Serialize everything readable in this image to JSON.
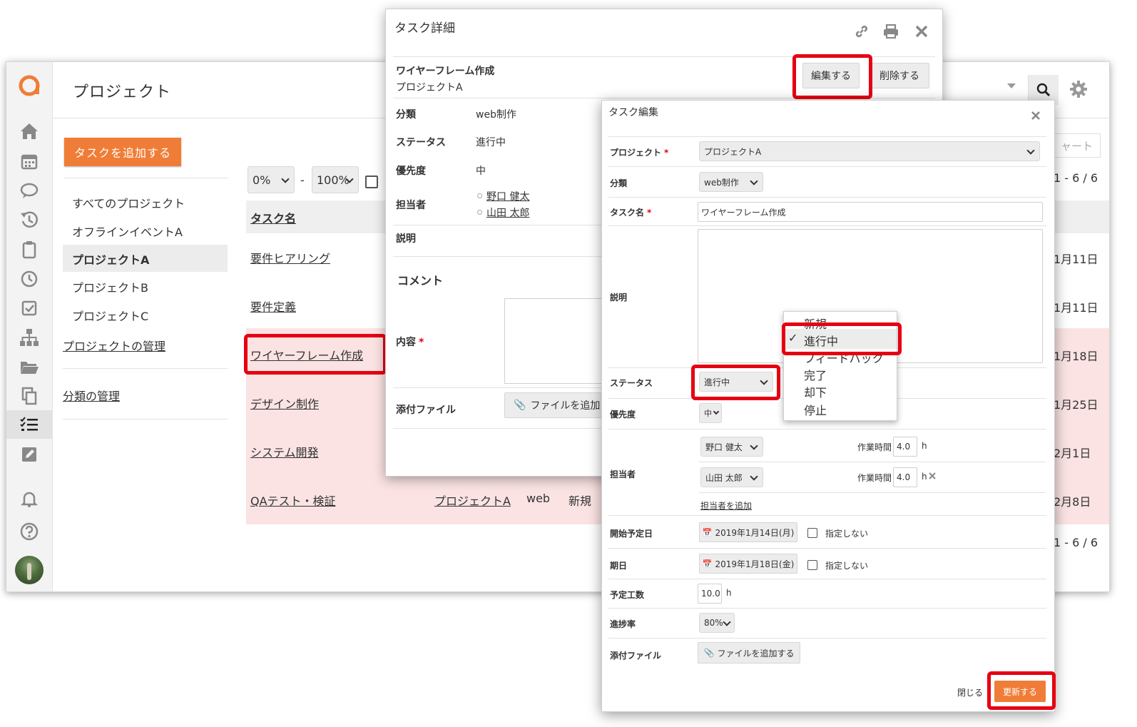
{
  "app": {
    "page_title": "プロジェクト",
    "add_task_button": "タスクを追加する",
    "sidebar": {
      "items": [
        {
          "label": "すべてのプロジェクト"
        },
        {
          "label": "オフラインイベントA"
        },
        {
          "label": "プロジェクトA"
        },
        {
          "label": "プロジェクトB"
        },
        {
          "label": "プロジェクトC"
        }
      ],
      "manage_projects": "プロジェクトの管理",
      "manage_categories": "分類の管理"
    },
    "filter": {
      "from": "0%",
      "dash": "-",
      "to": "100%"
    },
    "table": {
      "header_task": "タスク名",
      "rows": [
        {
          "name": "要件ヒアリング",
          "date": "1月11日"
        },
        {
          "name": "要件定義",
          "date": "1月11日"
        },
        {
          "name": "ワイヤーフレーム作成",
          "date": "1月18日"
        },
        {
          "name": "デザイン制作",
          "date": "1月25日"
        },
        {
          "name": "システム開発",
          "date": "2月1日"
        },
        {
          "name": "QAテスト・検証",
          "date": "2月8日",
          "project": "プロジェクトA",
          "category": "web",
          "status": "新規"
        }
      ],
      "pager_top": "1 - 6 / 6",
      "pager_bottom": "1 - 6 / 6",
      "chart_button": "ャート"
    },
    "accent_color": "#f07d37",
    "highlight_color": "#e60012"
  },
  "detail": {
    "title": "タスク詳細",
    "task_name": "ワイヤーフレーム作成",
    "project": "プロジェクトA",
    "edit_button": "編集する",
    "delete_button": "削除する",
    "fields": {
      "category_label": "分類",
      "category": "web制作",
      "status_label": "ステータス",
      "status": "進行中",
      "priority_label": "優先度",
      "priority": "中",
      "assignee_label": "担当者",
      "assignees": [
        "野口 健太",
        "山田 太郎"
      ],
      "description_label": "説明"
    },
    "comment_title": "コメント",
    "content_label": "内容",
    "attachment_label": "添付ファイル",
    "add_file_button": "ファイルを追加"
  },
  "edit": {
    "title": "タスク編集",
    "project_label": "プロジェクト",
    "project": "プロジェクトA",
    "category_label": "分類",
    "category": "web制作",
    "task_name_label": "タスク名",
    "task_name": "ワイヤーフレーム作成",
    "description_label": "説明",
    "status_label": "ステータス",
    "status": "進行中",
    "status_options": [
      "新規",
      "進行中",
      "フィードバック",
      "完了",
      "却下",
      "停止"
    ],
    "priority_label": "優先度",
    "priority": "中",
    "assignee_label": "担当者",
    "assignees": [
      {
        "name": "野口 健太",
        "hours_label": "作業時間",
        "hours": "4.0",
        "unit": "h"
      },
      {
        "name": "山田 太郎",
        "hours_label": "作業時間",
        "hours": "4.0",
        "unit": "h"
      }
    ],
    "add_assignee": "担当者を追加",
    "start_label": "開始予定日",
    "start": "2019年1月14日(月)",
    "due_label": "期日",
    "due": "2019年1月18日(金)",
    "unspecified": "指定しない",
    "estimate_label": "予定工数",
    "estimate": "10.0",
    "estimate_unit": "h",
    "progress_label": "進捗率",
    "progress": "80%",
    "attachment_label": "添付ファイル",
    "add_file_button": "ファイルを追加する",
    "close_button": "閉じる",
    "update_button": "更新する"
  }
}
